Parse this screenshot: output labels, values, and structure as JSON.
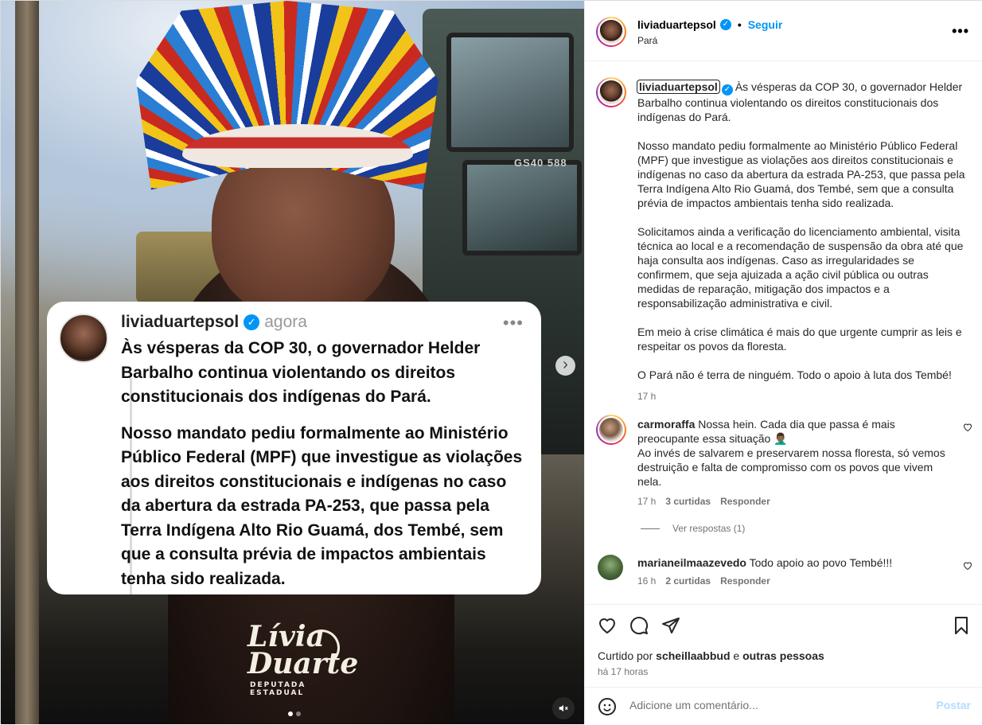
{
  "author": {
    "username": "liviaduartepsol",
    "follow_label": "Seguir",
    "location": "Pará",
    "more_label": "•••"
  },
  "media": {
    "truck_code": "GS40 588",
    "card": {
      "username": "liviaduartepsol",
      "time": "agora",
      "more_label": "•••",
      "paragraph_1": "Às vésperas da COP 30, o governador Helder Barbalho continua violentando os direitos constitucionais dos indígenas do Pará.",
      "paragraph_2": "Nosso mandato pediu formalmente ao Ministério Público Federal (MPF) que investigue as violações aos direitos constitucionais e indígenas no caso da abertura da estrada PA-253, que passa pela Terra Indígena Alto Rio Guamá, dos Tembé, sem que a consulta prévia de impactos ambientais tenha sido realizada."
    },
    "logo": {
      "line1": "Lívia",
      "line2": "Duarte",
      "subtitle": "DEPUTADA ESTADUAL"
    },
    "next_label": "›",
    "mute_label": "🔇",
    "slide_count": 2,
    "active_slide": 1
  },
  "caption": {
    "username": "liviaduartepsol",
    "paragraph_1": "Às vésperas da COP 30, o governador Helder Barbalho continua violentando os direitos constitucionais dos indígenas do Pará.",
    "paragraph_2": "Nosso mandato pediu formalmente ao Ministério Público Federal (MPF) que investigue as violações aos direitos constitucionais e indígenas no caso da abertura da estrada PA-253, que passa pela Terra Indígena Alto Rio Guamá, dos Tembé, sem que a consulta prévia de impactos ambientais tenha sido realizada.",
    "paragraph_3": "Solicitamos ainda a verificação do licenciamento ambiental, visita técnica ao local e a recomendação de suspensão da obra até que haja consulta aos indígenas. Caso as irregularidades se confirmem, que seja ajuizada a ação civil pública ou outras medidas de reparação, mitigação dos impactos e a responsabilização administrativa e civil.",
    "paragraph_4": "Em meio à crise climática é mais do que urgente cumprir as leis e respeitar os povos da floresta.",
    "paragraph_5": "O Pará não é terra de ninguém. Todo o apoio à luta dos Tembé!",
    "time": "17 h"
  },
  "comments": [
    {
      "username": "carmoraffa",
      "text_1": "Nossa hein. Cada dia que passa é mais preocupante essa situação 🤦🏾‍♂️",
      "text_2": "Ao invés de salvarem e preservarem nossa floresta, só vemos destruição e falta de compromisso com os povos que vivem nela.",
      "time": "17 h",
      "likes": "3 curtidas",
      "reply_label": "Responder",
      "view_replies": "Ver respostas (1)"
    },
    {
      "username": "marianeilmaazevedo",
      "text_1": "Todo apoio ao povo Tembé!!!",
      "time": "16 h",
      "likes": "2 curtidas",
      "reply_label": "Responder"
    }
  ],
  "footer": {
    "liked_prefix": "Curtido por",
    "liked_user": "scheillaabbud",
    "liked_and": "e",
    "liked_others": "outras pessoas",
    "posted_ago": "há 17 horas",
    "comment_placeholder": "Adicione um comentário...",
    "post_label": "Postar"
  },
  "colors": {
    "accent": "#0095f6",
    "post_disabled": "#b3dbff",
    "meta_text": "#737373"
  }
}
